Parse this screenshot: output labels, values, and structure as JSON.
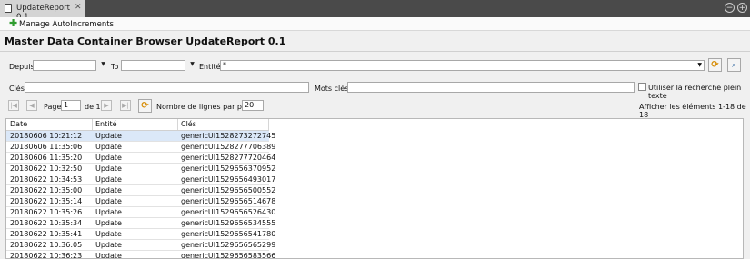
{
  "tab": {
    "title": "UpdateReport 0.1",
    "close": "✕"
  },
  "window_buttons": {
    "minimize": "−",
    "maximize": "+"
  },
  "toolbar": {
    "manage_label": "Manage AutoIncrements"
  },
  "page_title": "Master Data Container Browser UpdateReport 0.1",
  "filters": {
    "depuis_label": "Depuis",
    "to_label": "To",
    "entite_label": "Entité",
    "entite_value": "*",
    "cles_label": "Clés",
    "motscles_label": "Mots clés",
    "fulltext_label": "Utiliser la recherche plein texte"
  },
  "pager": {
    "page_label": "Page",
    "page_value": "1",
    "of_label": "de 1",
    "rows_per_page_label": "Nombre de lignes par page:",
    "rows_per_page_value": "20",
    "summary": "Afficher les éléments 1-18 de 18"
  },
  "table": {
    "columns": [
      "Date",
      "Entité",
      "Clés"
    ],
    "rows": [
      [
        "20180606 10:21:12",
        "Update",
        "genericUI1528273272745"
      ],
      [
        "20180606 11:35:06",
        "Update",
        "genericUI1528277706389"
      ],
      [
        "20180606 11:35:20",
        "Update",
        "genericUI1528277720464"
      ],
      [
        "20180622 10:32:50",
        "Update",
        "genericUI1529656370952"
      ],
      [
        "20180622 10:34:53",
        "Update",
        "genericUI1529656493017"
      ],
      [
        "20180622 10:35:00",
        "Update",
        "genericUI1529656500552"
      ],
      [
        "20180622 10:35:14",
        "Update",
        "genericUI1529656514678"
      ],
      [
        "20180622 10:35:26",
        "Update",
        "genericUI1529656526430"
      ],
      [
        "20180622 10:35:34",
        "Update",
        "genericUI1529656534555"
      ],
      [
        "20180622 10:35:41",
        "Update",
        "genericUI1529656541780"
      ],
      [
        "20180622 10:36:05",
        "Update",
        "genericUI1529656565299"
      ],
      [
        "20180622 10:36:23",
        "Update",
        "genericUI1529656583566"
      ]
    ]
  },
  "colors": {
    "tabbar": "#4a4a4a",
    "selected_row": "#dbe8f8",
    "accent_gold": "#d68a00",
    "plus_green": "#2e9c2e"
  }
}
